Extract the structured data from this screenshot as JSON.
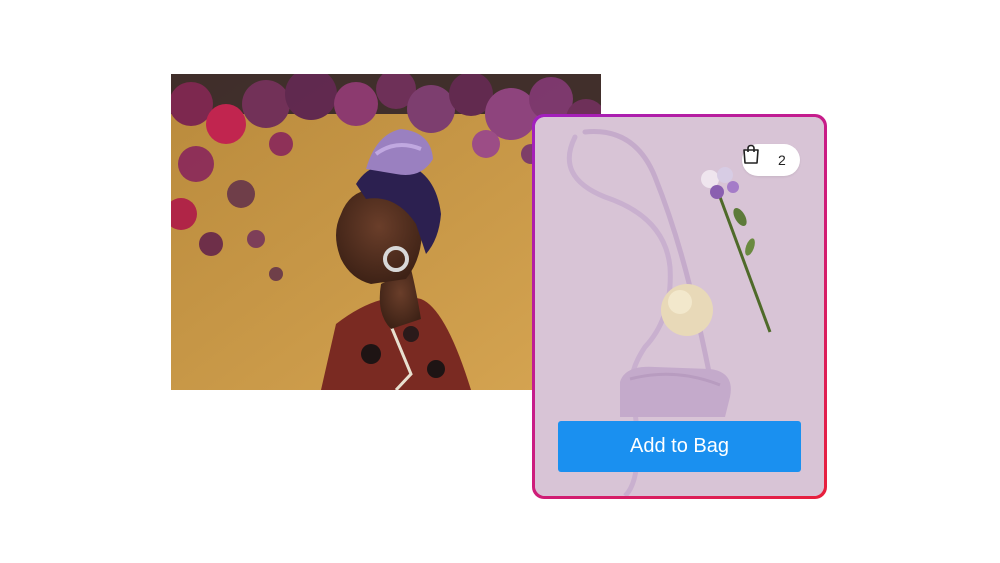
{
  "product_card": {
    "bag_count": "2",
    "bag_icon": "shopping-bag-icon",
    "cta_label": "Add to Bag",
    "cta_color": "#1a90f0",
    "border_gradient": [
      "#a020c0",
      "#e8203c"
    ]
  },
  "images": {
    "portrait": "woman-profile-with-flowers-photo",
    "product": "lilac-shoulder-bag-product-photo"
  }
}
